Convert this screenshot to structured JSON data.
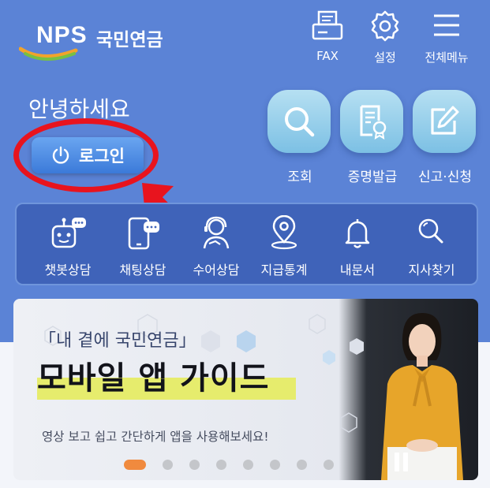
{
  "header": {
    "logo_text": "NPS",
    "logo_korean": "국민연금",
    "fax_label": "FAX",
    "settings_label": "설정",
    "menu_label": "전체메뉴"
  },
  "greeting": "안녕하세요",
  "login_label": "로그인",
  "quick_actions": [
    {
      "label": "조회",
      "icon": "search-icon"
    },
    {
      "label": "증명발급",
      "icon": "certificate-icon"
    },
    {
      "label": "신고·신청",
      "icon": "edit-icon"
    }
  ],
  "services": [
    {
      "label": "챗봇상담",
      "icon": "chatbot-icon"
    },
    {
      "label": "채팅상담",
      "icon": "chat-phone-icon"
    },
    {
      "label": "수어상담",
      "icon": "sign-language-icon"
    },
    {
      "label": "지급통계",
      "icon": "location-stats-icon"
    },
    {
      "label": "내문서",
      "icon": "bell-icon"
    },
    {
      "label": "지사찾기",
      "icon": "search-icon"
    }
  ],
  "banner": {
    "subtitle": "「내 곁에 국민연금」",
    "title": "모바일 앱 가이드",
    "description": "영상 보고 쉽고 간단하게 앱을 사용해보세요!",
    "slide_count": 9,
    "active_slide": 1
  },
  "colors": {
    "background": "#5b83d6",
    "service_bar": "#3f63b9",
    "highlight": "#e6ec6d",
    "annotation_red": "#e8141e",
    "active_dot": "#f08a3e"
  }
}
